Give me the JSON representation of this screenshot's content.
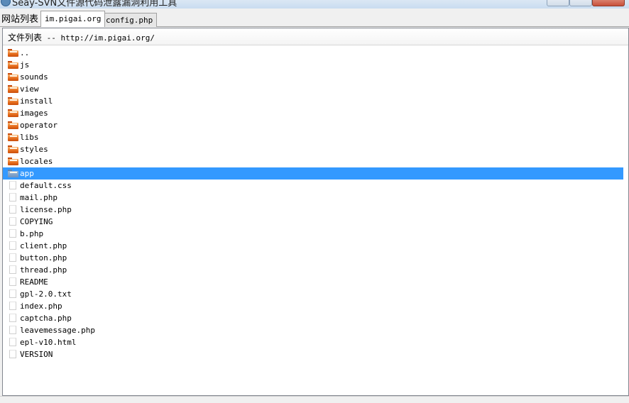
{
  "window": {
    "title": "Seay-SVN文件源代码泄露漏洞利用工具"
  },
  "tabs": [
    {
      "label": "网站列表",
      "active": false
    },
    {
      "label": "im.pigai.org",
      "active": true
    },
    {
      "label": "config.php",
      "active": false
    }
  ],
  "panel": {
    "header_label": "文件列表",
    "header_separator": " -- ",
    "header_url": "http://im.pigai.org/"
  },
  "files": [
    {
      "name": "..",
      "icon": "folder-icon"
    },
    {
      "name": "js",
      "icon": "folder-icon"
    },
    {
      "name": "sounds",
      "icon": "folder-icon"
    },
    {
      "name": "view",
      "icon": "folder-icon"
    },
    {
      "name": "install",
      "icon": "folder-icon"
    },
    {
      "name": "images",
      "icon": "folder-icon"
    },
    {
      "name": "operator",
      "icon": "folder-icon"
    },
    {
      "name": "libs",
      "icon": "folder-icon"
    },
    {
      "name": "styles",
      "icon": "folder-icon"
    },
    {
      "name": "locales",
      "icon": "folder-icon"
    },
    {
      "name": "app",
      "icon": "folder-icon",
      "selected": true
    },
    {
      "name": "default.css",
      "icon": "file-icon"
    },
    {
      "name": "mail.php",
      "icon": "file-icon"
    },
    {
      "name": "license.php",
      "icon": "file-icon"
    },
    {
      "name": "COPYING",
      "icon": "file-icon"
    },
    {
      "name": "b.php",
      "icon": "file-icon"
    },
    {
      "name": "client.php",
      "icon": "file-icon"
    },
    {
      "name": "button.php",
      "icon": "file-icon"
    },
    {
      "name": "thread.php",
      "icon": "file-icon"
    },
    {
      "name": "README",
      "icon": "file-icon"
    },
    {
      "name": "gpl-2.0.txt",
      "icon": "file-icon"
    },
    {
      "name": "index.php",
      "icon": "file-icon"
    },
    {
      "name": "captcha.php",
      "icon": "file-icon"
    },
    {
      "name": "leavemessage.php",
      "icon": "file-icon"
    },
    {
      "name": "epl-v10.html",
      "icon": "file-icon"
    },
    {
      "name": "VERSION",
      "icon": "file-icon"
    }
  ],
  "colors": {
    "selection": "#3399ff",
    "folder": "#e56a1a"
  }
}
